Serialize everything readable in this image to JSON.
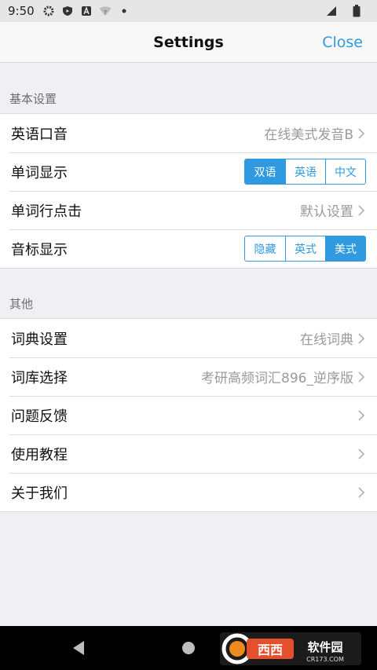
{
  "status_bar": {
    "time": "9:50"
  },
  "nav": {
    "title": "Settings",
    "close_label": "Close"
  },
  "sections": {
    "basic": {
      "header": "基本设置",
      "rows": {
        "accent": {
          "label": "英语口音",
          "value": "在线美式发音B"
        },
        "word_display": {
          "label": "单词显示",
          "options": [
            "双语",
            "英语",
            "中文"
          ],
          "selected": "双语"
        },
        "word_row_tap": {
          "label": "单词行点击",
          "value": "默认设置"
        },
        "phonetic_display": {
          "label": "音标显示",
          "options": [
            "隐藏",
            "英式",
            "美式"
          ],
          "selected": "美式"
        }
      }
    },
    "other": {
      "header": "其他",
      "rows": {
        "dictionary": {
          "label": "词典设置",
          "value": "在线词典"
        },
        "wordbank": {
          "label": "词库选择",
          "value": "考研高频词汇896_逆序版"
        },
        "feedback": {
          "label": "问题反馈"
        },
        "tutorial": {
          "label": "使用教程"
        },
        "about": {
          "label": "关于我们"
        }
      }
    }
  },
  "colors": {
    "accent": "#2f9ae0",
    "background": "#efeff4",
    "nav_background": "#f8f8f8"
  },
  "watermark": {
    "text": "西西软件园",
    "domain": "CR173.COM"
  }
}
